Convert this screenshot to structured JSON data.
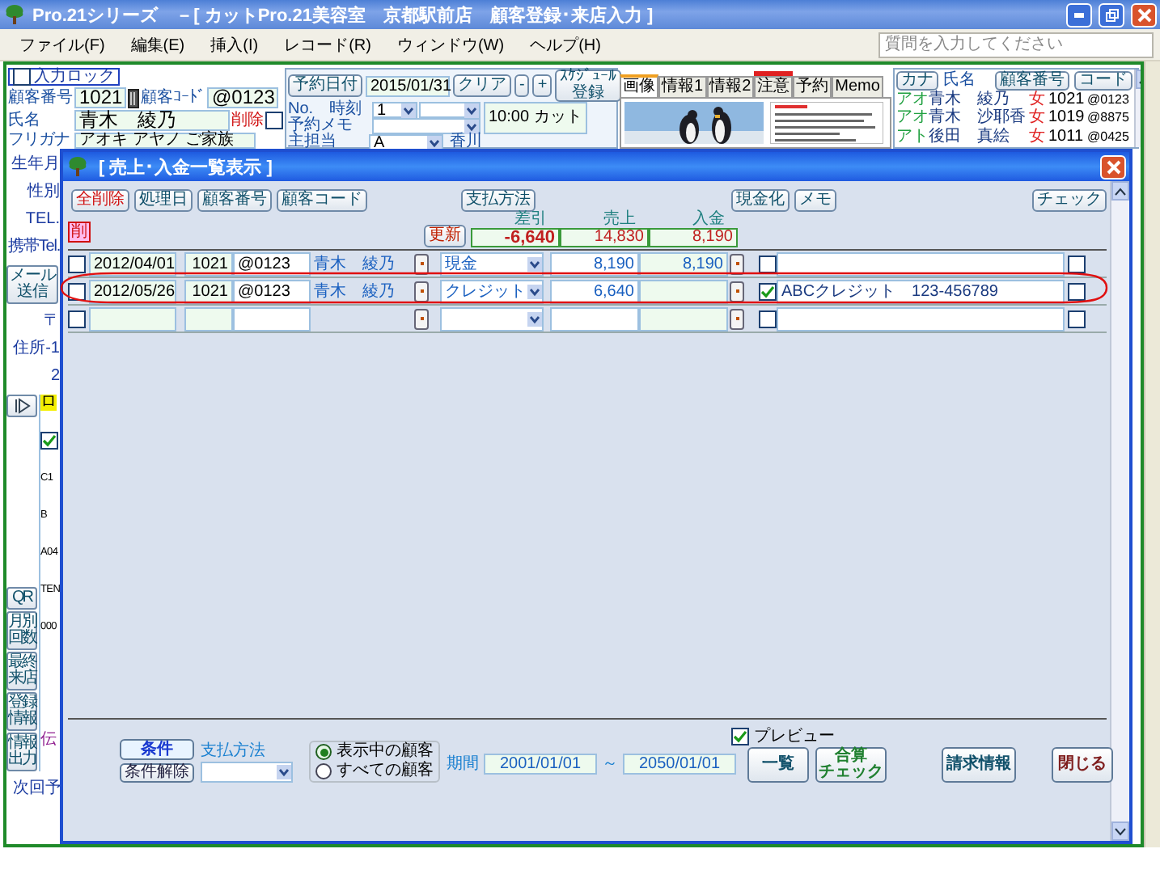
{
  "window": {
    "title": "Pro.21シリーズ　－[ カットPro.21美容室　京都駅前店　顧客登録･来店入力 ]"
  },
  "menu": [
    "ファイル(F)",
    "編集(E)",
    "挿入(I)",
    "レコード(R)",
    "ウィンドウ(W)",
    "ヘルプ(H)"
  ],
  "help_search": {
    "placeholder": "質問を入力してください"
  },
  "customer": {
    "input_lock": {
      "label": "入力ロック",
      "checked": false
    },
    "number_label": "顧客番号",
    "number": "1021",
    "code_label": "顧客ｺｰﾄﾞ",
    "code": "@0123",
    "name_label": "氏名",
    "name": "青木　綾乃",
    "delete": {
      "label": "削除",
      "checked": false
    },
    "furigana_label": "フリガナ",
    "furigana": "アオキ アヤノ ご家族"
  },
  "reservation": {
    "date_button": "予約日付",
    "date": "2015/01/31",
    "clear_button": "クリア",
    "minus_button": "-",
    "plus_button": "+",
    "schedule_button": [
      "ｽｹｼﾞｭｰﾙ",
      "登録"
    ],
    "no_time_label": "No.　時刻",
    "memo_label": "予約メモ",
    "no": "1",
    "time_menu": "10:00 カット",
    "staff_label": "主担当",
    "staff_rank": "A",
    "staff": "香川"
  },
  "tabs": [
    {
      "label": "画像",
      "selected": true,
      "alert": false
    },
    {
      "label": "情報1",
      "selected": false,
      "alert": false
    },
    {
      "label": "情報2",
      "selected": false,
      "alert": false
    },
    {
      "label": "注意",
      "selected": false,
      "alert": true
    },
    {
      "label": "予約",
      "selected": false,
      "alert": false
    },
    {
      "label": "Memo",
      "selected": false,
      "alert": false
    }
  ],
  "customer_list": {
    "kana_button": "カナ",
    "name_header": "氏名",
    "number_button": "顧客番号",
    "code_button": "コード",
    "rows": [
      {
        "kana": "アオ",
        "name": "青木　綾乃",
        "gender": "女",
        "number": "1021",
        "code": "@0123"
      },
      {
        "kana": "アオ",
        "name": "青木　沙耶香",
        "gender": "女",
        "number": "1019",
        "code": "@8875"
      },
      {
        "kana": "アト",
        "name": "後田　真絵",
        "gender": "女",
        "number": "1011",
        "code": "@0425"
      }
    ]
  },
  "side_labels": [
    "生年月",
    "性別",
    "TEL.",
    "携帯Tel."
  ],
  "mail_button": [
    "メール",
    "送信"
  ],
  "address_labels": [
    "〒",
    "住所-1",
    "2"
  ],
  "side_buttons": [
    {
      "kind": "play"
    },
    {
      "kind": "text",
      "lines": [
        "QR"
      ]
    },
    {
      "kind": "text",
      "lines": [
        "月別",
        "回数"
      ]
    },
    {
      "kind": "text",
      "lines": [
        "最終",
        "来店"
      ]
    },
    {
      "kind": "text",
      "lines": [
        "登録",
        "情報"
      ]
    },
    {
      "kind": "text",
      "lines": [
        "情報",
        "出力"
      ]
    }
  ],
  "side_fields": [
    {
      "kind": "tag",
      "text": "ロ"
    },
    {
      "kind": "check",
      "checked": true
    },
    {
      "kind": "text",
      "text": "C1"
    },
    {
      "kind": "text",
      "text": "B"
    },
    {
      "kind": "text",
      "text": "A04"
    },
    {
      "kind": "text",
      "text": "TEN"
    },
    {
      "kind": "text",
      "text": "000"
    },
    {
      "kind": "note",
      "text": "伝"
    }
  ],
  "next_label": "次回予",
  "dialog": {
    "title": "[ 売上･入金一覧表示 ]",
    "toolbar": [
      [
        {
          "label": "全削除",
          "kind": "danger"
        },
        {
          "label": "処理日",
          "kind": "normal"
        },
        {
          "label": "顧客番号",
          "kind": "normal"
        },
        {
          "label": "顧客コード",
          "kind": "normal"
        }
      ],
      [
        {
          "label": "支払方法",
          "kind": "normal"
        }
      ],
      [
        {
          "label": "現金化",
          "kind": "normal"
        },
        {
          "label": "メモ",
          "kind": "normal"
        }
      ],
      [
        {
          "label": "チェック",
          "kind": "normal"
        }
      ]
    ],
    "delete_icon": "削",
    "update_button": "更新",
    "totals": [
      {
        "label": "差引",
        "value": "-6,640",
        "kind": "balance"
      },
      {
        "label": "売上",
        "value": "14,830",
        "kind": "sum"
      },
      {
        "label": "入金",
        "value": "8,190",
        "kind": "sum"
      }
    ],
    "rows": [
      {
        "checked": false,
        "date": "2012/04/01",
        "number": "1021",
        "code": "@0123",
        "name": "青木　綾乃",
        "payment": "現金",
        "sales": "8,190",
        "paid": "8,190",
        "memo_checked": false,
        "done": false
      },
      {
        "checked": false,
        "date": "2012/05/26",
        "number": "1021",
        "code": "@0123",
        "name": "青木　綾乃",
        "payment": "クレジット",
        "sales": "6,640",
        "memo_checked": true,
        "memo": "ABCクレジット　123-456789",
        "done": false
      },
      {
        "checked": false,
        "memo_checked": false,
        "done": false
      }
    ],
    "footer": {
      "condition_button": "条件",
      "clear_condition_button": "条件解除",
      "payment_label": "支払方法",
      "scope": [
        {
          "label": "表示中の顧客",
          "selected": true
        },
        {
          "label": "すべての顧客",
          "selected": false
        }
      ],
      "period_label": "期間",
      "date_from": "2001/01/01",
      "tilde": "～",
      "date_to": "2050/01/01",
      "preview": {
        "label": "プレビュー",
        "checked": true
      },
      "list_button": "一覧",
      "total_check_button": [
        "合算",
        "チェック"
      ],
      "billing_button": "請求情報",
      "close_button": "閉じる"
    }
  }
}
